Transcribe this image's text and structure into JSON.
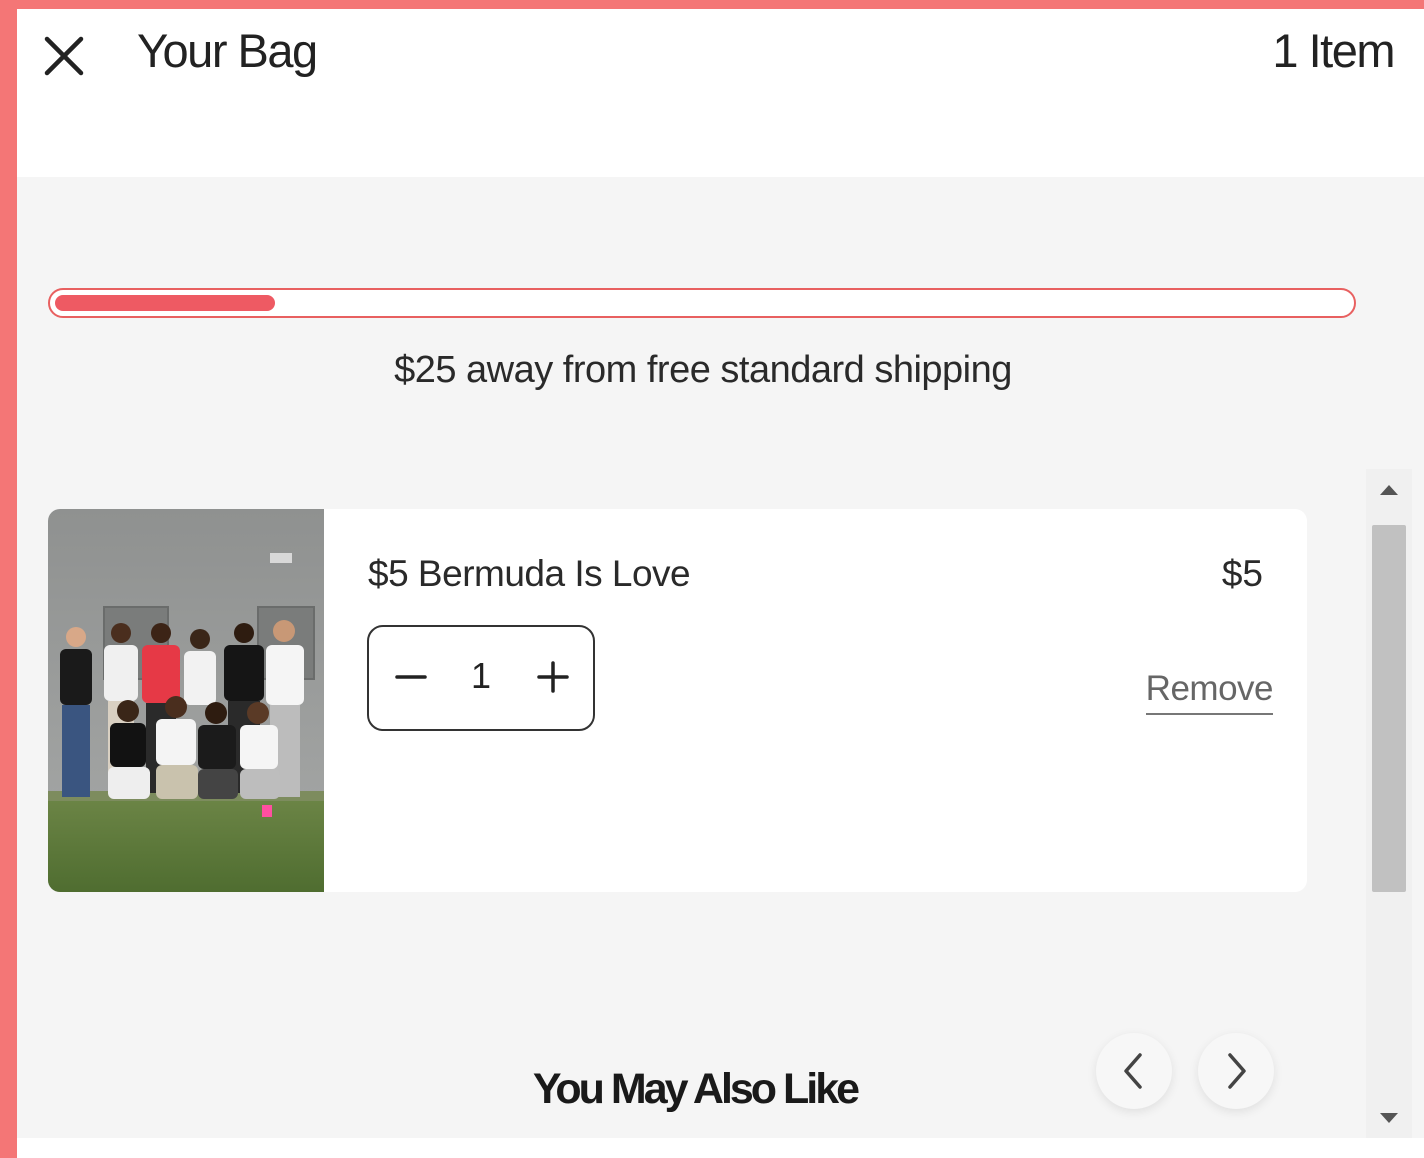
{
  "header": {
    "title": "Your Bag",
    "item_count": "1 Item"
  },
  "shipping": {
    "message": "$25 away from free standard shipping",
    "progress_fraction": 0.17,
    "accent_color": "#ee5a63"
  },
  "cart": {
    "items": [
      {
        "name": "$5 Bermuda Is Love",
        "price": "$5",
        "quantity": "1",
        "remove_label": "Remove",
        "image": "group-photo"
      }
    ]
  },
  "recommendations": {
    "title": "You May Also Like",
    "prev_icon": "chevron-left-icon",
    "next_icon": "chevron-right-icon"
  },
  "colors": {
    "page_frame": "#f47676",
    "panel_background": "#f5f5f5"
  }
}
